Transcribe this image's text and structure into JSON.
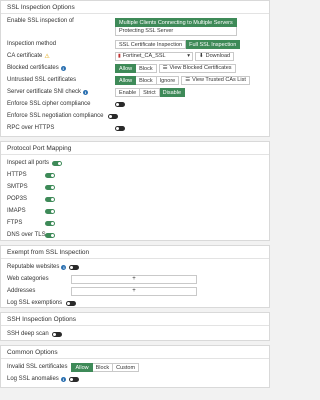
{
  "ssl": {
    "title": "SSL Inspection Options",
    "enable_label": "Enable SSL inspection of",
    "enable_options": [
      "Multiple Clients Connecting to Multiple Servers",
      "Protecting SSL Server"
    ],
    "method_label": "Inspection method",
    "method_options": [
      "SSL Certificate Inspection",
      "Full SSL Inspection"
    ],
    "ca_label": "CA certificate",
    "ca_value": "Fortinet_CA_SSL",
    "download_label": "Download",
    "blocked_label": "Blocked certificates",
    "blocked_options": [
      "Allow",
      "Block"
    ],
    "view_blocked_label": "View Blocked Certificates",
    "untrusted_label": "Untrusted SSL certificates",
    "untrusted_options": [
      "Allow",
      "Block",
      "Ignore"
    ],
    "view_trusted_label": "View Trusted CAs List",
    "sni_label": "Server certificate SNI check",
    "sni_options": [
      "Enable",
      "Strict",
      "Disable"
    ],
    "cipher_label": "Enforce SSL cipher compliance",
    "negotiation_label": "Enforce SSL negotiation compliance",
    "rpc_label": "RPC over HTTPS"
  },
  "ports": {
    "title": "Protocol Port Mapping",
    "inspect_all_label": "Inspect all ports",
    "items": [
      "HTTPS",
      "SMTPS",
      "POP3S",
      "IMAPS",
      "FTPS",
      "DNS over TLS"
    ]
  },
  "exempt": {
    "title": "Exempt from SSL Inspection",
    "reputable_label": "Reputable websites",
    "web_categories_label": "Web categories",
    "addresses_label": "Addresses",
    "log_exemptions_label": "Log SSL exemptions",
    "add_symbol": "+"
  },
  "ssh": {
    "title": "SSH Inspection Options",
    "deep_scan_label": "SSH deep scan"
  },
  "common": {
    "title": "Common Options",
    "invalid_label": "Invalid SSL certificates",
    "invalid_options": [
      "Allow",
      "Block",
      "Custom"
    ],
    "log_anomalies_label": "Log SSL anomalies"
  }
}
